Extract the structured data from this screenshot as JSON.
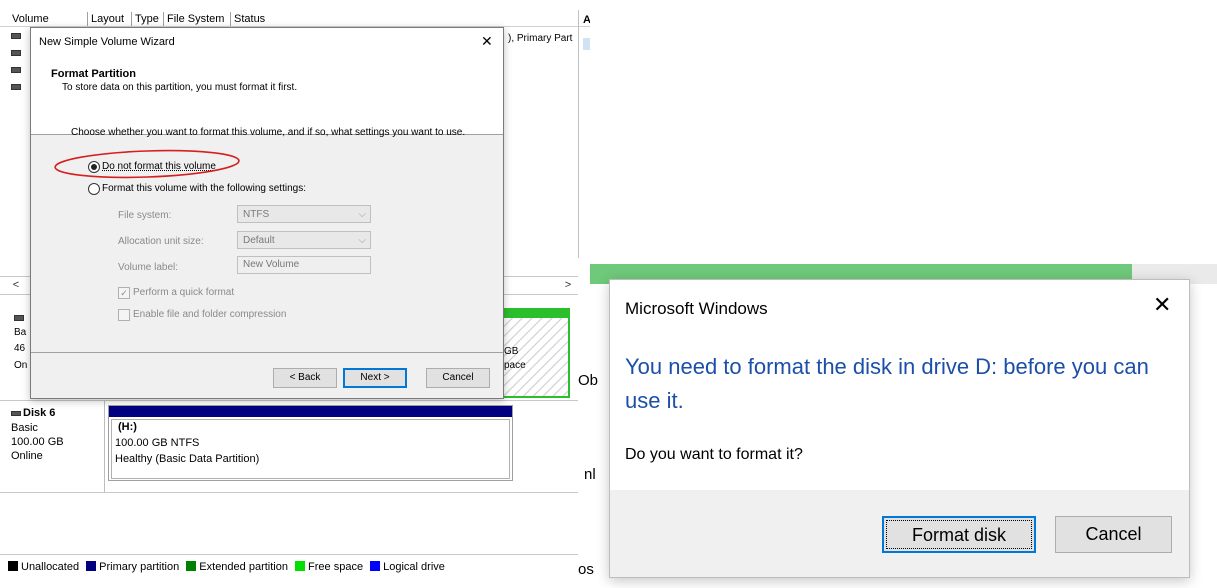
{
  "disk_management": {
    "columns": [
      "Volume",
      "Layout",
      "Type",
      "File System",
      "Status"
    ],
    "status_cell_fragment": "), Primary Part",
    "right_pane_header_fragment": "A",
    "disk_left_fragments": {
      "a": "Ba",
      "b": "46",
      "c": "On"
    },
    "partition_fragment": {
      "size": "GB",
      "label": "pace"
    },
    "disk6": {
      "name": "Disk 6",
      "type": "Basic",
      "size": "100.00 GB",
      "status": "Online",
      "partition": {
        "letter": "(H:)",
        "size_fs": "100.00 GB NTFS",
        "health": "Healthy (Basic Data Partition)"
      }
    },
    "legend": [
      {
        "label": "Unallocated",
        "color": "#000000"
      },
      {
        "label": "Primary partition",
        "color": "#000080"
      },
      {
        "label": "Extended partition",
        "color": "#008000"
      },
      {
        "label": "Free space",
        "color": "#00e000"
      },
      {
        "label": "Logical drive",
        "color": "#0000ff"
      }
    ]
  },
  "wizard": {
    "title": "New Simple Volume Wizard",
    "close_glyph": "✕",
    "heading": "Format Partition",
    "subheading": "To store data on this partition, you must format it first.",
    "instruction": "Choose whether you want to format this volume, and if so, what settings you want to use.",
    "option_no_format": "Do not format this volume",
    "option_format": "Format this volume with the following settings:",
    "file_system_label": "File system:",
    "file_system_value": "NTFS",
    "allocation_label": "Allocation unit size:",
    "allocation_value": "Default",
    "volume_label_label": "Volume label:",
    "volume_label_value": "New Volume",
    "quick_format_label": "Perform a quick format",
    "compression_label": "Enable file and folder compression",
    "back_button": "< Back",
    "next_button": "Next >",
    "cancel_button": "Cancel"
  },
  "msgbox": {
    "title": "Microsoft Windows",
    "close_glyph": "✕",
    "message": "You need to format the disk in drive D: before you can use it.",
    "question": "Do you want to format it?",
    "format_button": "Format disk",
    "cancel_button": "Cancel",
    "bg_fragments": {
      "a": "Ob",
      "b": "nl",
      "c": "os"
    }
  },
  "colors": {
    "accent": "#0078d7",
    "message_text": "#1c4fa8",
    "annotation_red": "#d62020",
    "green_bar": "#6fc97a"
  }
}
